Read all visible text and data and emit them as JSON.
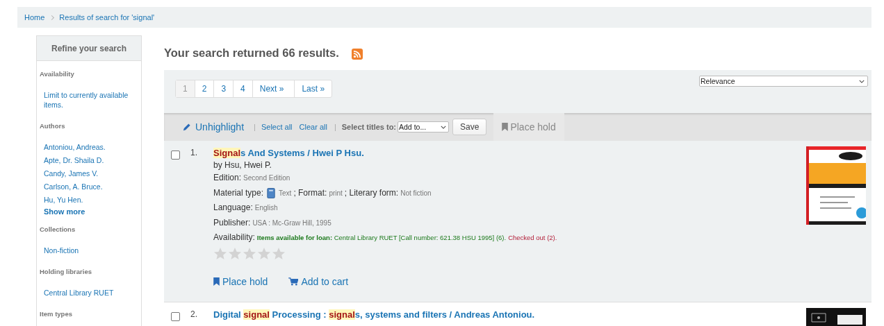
{
  "breadcrumb": [
    {
      "label": "Home"
    },
    {
      "label": "Results of search for 'signal'"
    }
  ],
  "sidebar": {
    "title": "Refine your search",
    "sections": [
      {
        "heading": "Availability",
        "items": [
          {
            "label": "Limit to currently available items."
          }
        ]
      },
      {
        "heading": "Authors",
        "items": [
          {
            "label": "Antoniou, Andreas."
          },
          {
            "label": "Apte, Dr. Shaila D."
          },
          {
            "label": "Candy, James V."
          },
          {
            "label": "Carlson, A. Bruce."
          },
          {
            "label": "Hu, Yu Hen."
          }
        ],
        "more": "Show more"
      },
      {
        "heading": "Collections",
        "items": [
          {
            "label": "Non-fiction"
          }
        ]
      },
      {
        "heading": "Holding libraries",
        "items": [
          {
            "label": "Central Library RUET"
          }
        ]
      },
      {
        "heading": "Item types"
      }
    ]
  },
  "heading": "Your search returned 66 results.",
  "pagination": [
    {
      "label": "1",
      "selected": true
    },
    {
      "label": "2",
      "selected": false
    },
    {
      "label": "3",
      "selected": false
    },
    {
      "label": "4",
      "selected": false
    },
    {
      "label": "Next »",
      "selected": false
    },
    {
      "label": "Last »",
      "selected": false
    }
  ],
  "sort": {
    "value": "Relevance"
  },
  "toolbar": {
    "unhighlight": "Unhighlight",
    "separators": [
      "|",
      "|"
    ],
    "select_all": "Select all",
    "clear_all": "Clear all",
    "select_titles": "Select titles to:",
    "add_to": "Add to...",
    "save": "Save",
    "place_hold": {
      "label": "Place hold",
      "disabled": true
    }
  },
  "results": [
    {
      "number": "1.",
      "checked": false,
      "title": [
        {
          "text": "Signal",
          "highlight": true
        },
        {
          "text": "s And Systems / Hwei P Hsu.",
          "highlight": false
        }
      ],
      "byline": "by Hsu, Hwei P.",
      "details": [
        [
          {
            "label": "Edition:",
            "value": "Second Edition"
          }
        ],
        [
          {
            "label": "Material type:",
            "value": "Text",
            "icon": true
          },
          {
            "label": "; Format:",
            "value": "print"
          },
          {
            "label": "; Literary form:",
            "value": "Not fiction"
          }
        ],
        [
          {
            "label": "Language:",
            "value": "English"
          }
        ],
        [
          {
            "label": "Publisher:",
            "value": "USA : Mc-Graw Hill, 1995"
          }
        ]
      ],
      "availability": {
        "label": "Availability:",
        "available": "**Items available for loan:** Central Library RUET [Call number: 621.38 HSU 1995] (6).",
        "checked_out": "Checked out (2)."
      },
      "stars": 0,
      "actions": [
        "Place hold",
        "Add to cart"
      ],
      "cover": {
        "kind": "picture"
      }
    },
    {
      "number": "2.",
      "checked": false,
      "title": [
        {
          "text": "Digital ",
          "highlight": false
        },
        {
          "text": "signal",
          "highlight": true
        },
        {
          "text": " Processing : ",
          "highlight": false
        },
        {
          "text": "signal",
          "highlight": true
        },
        {
          "text": "s, systems and filters / Andreas Antoniou.",
          "highlight": false
        }
      ],
      "cover": {
        "kind": "picture"
      }
    }
  ]
}
